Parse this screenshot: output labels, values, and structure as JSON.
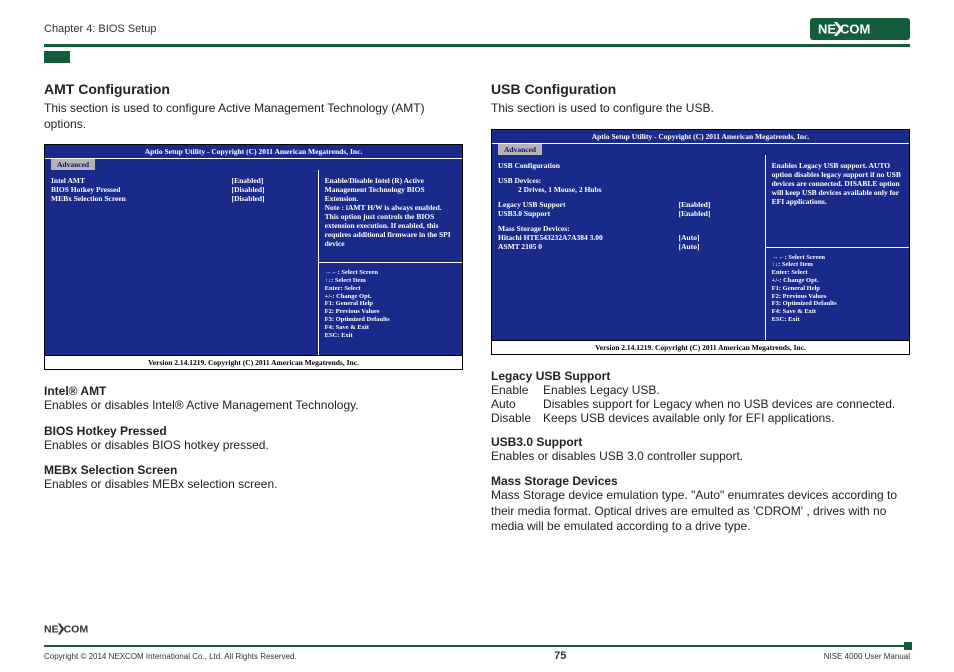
{
  "header": {
    "chapter": "Chapter 4: BIOS Setup",
    "logoText": "NEXCOM"
  },
  "left": {
    "title": "AMT Configuration",
    "desc": "This section is used to configure Active Management Technology (AMT) options.",
    "bios": {
      "top": "Aptio Setup Utility - Copyright (C) 2011 American Megatrends, Inc.",
      "tab": "Advanced",
      "rows": [
        {
          "name": "Intel AMT",
          "val": "[Enabled]"
        },
        {
          "name": "BIOS Hotkey Pressed",
          "val": "[Disabled]"
        },
        {
          "name": "MEBx Selection Screen",
          "val": "[Disabled]"
        }
      ],
      "help": "Enable/Disable Intel (R) Active Management Technology BIOS Extension.\nNote : iAMT H/W is always enabled.\nThis option just controls the BIOS extension execution. If enabled, this requires additional firmware in the SPI device",
      "keys": "→←: Select Screen\n↑↓: Select Item\nEnter: Select\n+/-: Change Opt.\nF1: General Help\nF2: Previous Values\nF3: Optimized Defaults\nF4: Save & Exit\nESC: Exit",
      "bottom": "Version 2.14.1219. Copyright (C) 2011 American Megatrends, Inc."
    },
    "fields": [
      {
        "t": "Intel® AMT",
        "b": "Enables or disables Intel® Active Management Technology."
      },
      {
        "t": "BIOS Hotkey Pressed",
        "b": "Enables or disables BIOS hotkey pressed."
      },
      {
        "t": "MEBx Selection Screen",
        "b": "Enables or disables MEBx selection screen."
      }
    ]
  },
  "right": {
    "title": "USB Configuration",
    "desc": "This section is used to configure the USB.",
    "bios": {
      "top": "Aptio Setup Utility - Copyright (C) 2011 American Megatrends, Inc.",
      "tab": "Advanced",
      "h1": "USB Configuration",
      "h2": "USB Devices:",
      "h2b": "2 Drives, 1 Mouse, 2 Hubs",
      "rows1": [
        {
          "name": "Legacy USB Support",
          "val": "[Enabled]"
        },
        {
          "name": "USB3.0 Support",
          "val": "[Enabled]"
        }
      ],
      "h3": "Mass Storage Devices:",
      "rows2": [
        {
          "name": "Hitachi HTE543232A7A384 3.00",
          "val": "[Auto]"
        },
        {
          "name": "ASMT 2105 0",
          "val": "[Auto]"
        }
      ],
      "help": "Enables Legacy USB support. AUTO option disables legacy support if no USB devices are connected. DISABLE option will keep USB devices available only for EFI applications.",
      "keys": "→←: Select Screen\n↑↓: Select Item\nEnter: Select\n+/-: Change Opt.\nF1: General Help\nF2: Previous Values\nF3: Optimized Defaults\nF4: Save & Exit\nESC: Exit",
      "bottom": "Version 2.14.1219. Copyright (C) 2011 American Megatrends, Inc."
    },
    "legacy": {
      "t": "Legacy USB Support",
      "rows": [
        {
          "k": "Enable",
          "v": "Enables Legacy USB."
        },
        {
          "k": "Auto",
          "v": "Disables support for Legacy when no USB devices are connected."
        },
        {
          "k": "Disable",
          "v": "Keeps USB devices available only for EFI applications."
        }
      ]
    },
    "usb3": {
      "t": "USB3.0 Support",
      "b": "Enables or disables USB 3.0 controller support."
    },
    "mass": {
      "t": "Mass Storage Devices",
      "b": "Mass Storage device emulation type. \"Auto\" enumrates devices according to their media format. Optical drives are emulted as 'CDROM' , drives with no media will be emulated according to a drive type."
    }
  },
  "footer": {
    "copy": "Copyright © 2014 NEXCOM International Co., Ltd. All Rights Reserved.",
    "page": "75",
    "manual": "NISE 4000 User Manual",
    "logo": "NEXCOM"
  }
}
